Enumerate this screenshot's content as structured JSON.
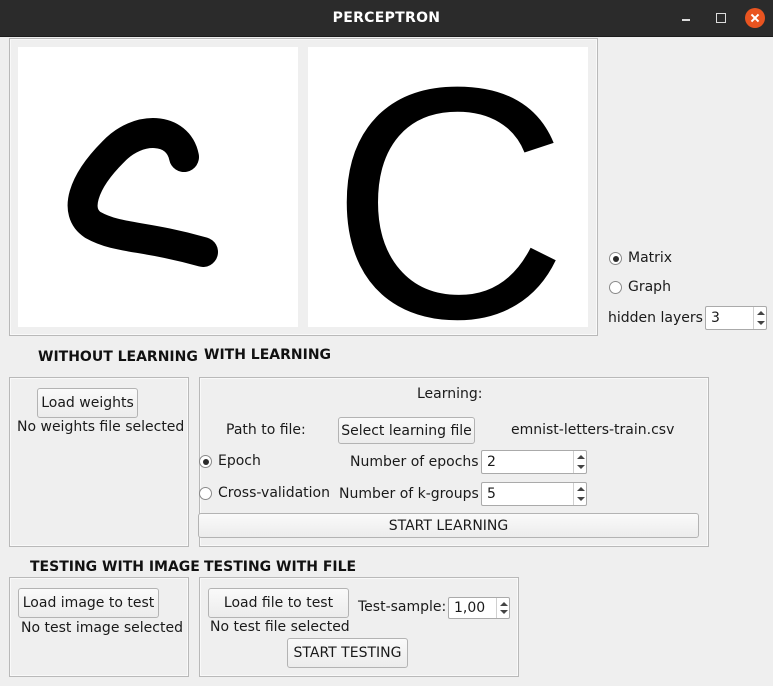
{
  "window": {
    "title": "PERCEPTRON"
  },
  "display_mode": {
    "matrix_label": "Matrix",
    "graph_label": "Graph",
    "selected": "Matrix",
    "hidden_layers_label": "hidden layers",
    "hidden_layers_value": "3"
  },
  "without_learning": {
    "heading": "WITHOUT LEARNING",
    "load_weights_label": "Load weights",
    "status": "No weights file selected"
  },
  "with_learning": {
    "heading": "WITH LEARNING",
    "group_title": "Learning:",
    "path_label": "Path to file:",
    "select_file_label": "Select learning file",
    "file_name": "emnist-letters-train.csv",
    "epoch_label": "Epoch",
    "cross_validation_label": "Cross-validation",
    "selected_mode": "Epoch",
    "epochs_label": "Number of epochs",
    "epochs_value": "2",
    "kgroups_label": "Number of k-groups",
    "kgroups_value": "5",
    "start_label": "START LEARNING"
  },
  "testing_image": {
    "heading": "TESTING WITH IMAGE",
    "load_label": "Load image to test",
    "status": "No test image selected"
  },
  "testing_file": {
    "heading": "TESTING WITH FILE",
    "load_label": "Load file to test",
    "status": "No test file selected",
    "sample_label": "Test-sample:",
    "sample_value": "1,00",
    "start_label": "START TESTING"
  },
  "prediction": {
    "letter": "C"
  }
}
